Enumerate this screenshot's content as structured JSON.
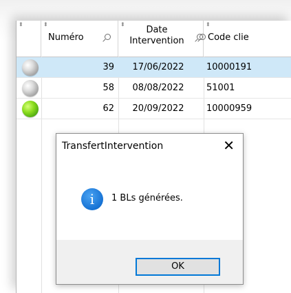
{
  "grid": {
    "columns": {
      "numero": "Numéro",
      "date_line1": "Date",
      "date_line2": "Intervention",
      "code": "Code clie"
    },
    "rows": [
      {
        "status": "grey",
        "numero": "39",
        "date": "17/06/2022",
        "code": "10000191",
        "selected": true
      },
      {
        "status": "grey",
        "numero": "58",
        "date": "08/08/2022",
        "code": "51001",
        "selected": false
      },
      {
        "status": "green",
        "numero": "62",
        "date": "20/09/2022",
        "code": "10000959",
        "selected": false
      }
    ]
  },
  "dialog": {
    "title": "TransfertIntervention",
    "close_glyph": "✕",
    "icon": "info-icon",
    "icon_glyph": "i",
    "message": "1 BLs générées.",
    "ok_label": "OK"
  },
  "colors": {
    "selected_row": "#cfe8f8",
    "ok_border": "#0078d7",
    "info_blue": "#1672d4"
  }
}
